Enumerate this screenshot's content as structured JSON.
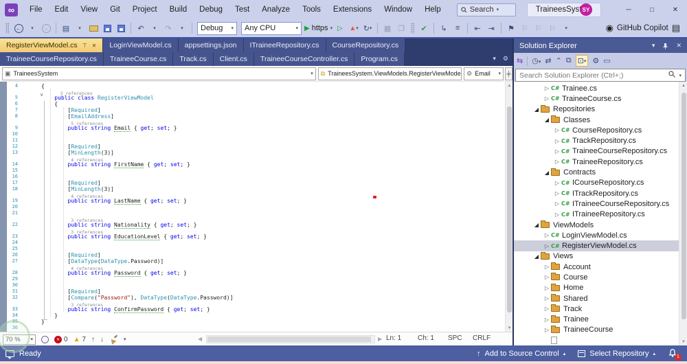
{
  "titlebar": {
    "menus": [
      "File",
      "Edit",
      "View",
      "Git",
      "Project",
      "Build",
      "Debug",
      "Test",
      "Analyze",
      "Tools",
      "Extensions",
      "Window",
      "Help"
    ],
    "search_label": "Search",
    "project_title": "TraineesSystem",
    "avatar": "SY"
  },
  "toolbar": {
    "debug_config": "Debug",
    "cpu": "Any CPU",
    "run_target": "https",
    "copilot_label": "GitHub Copilot"
  },
  "tabs": {
    "row1": [
      {
        "label": "RegisterViewModel.cs",
        "active": true
      },
      {
        "label": "LoginViewModel.cs"
      },
      {
        "label": "appsettings.json"
      },
      {
        "label": "ITraineeRepository.cs"
      },
      {
        "label": "CourseRepository.cs"
      }
    ],
    "row2": [
      {
        "label": "TraineeCourseRepository.cs"
      },
      {
        "label": "TraineeCourse.cs"
      },
      {
        "label": "Track.cs"
      },
      {
        "label": "Client.cs"
      },
      {
        "label": "TraineeCourseController.cs"
      },
      {
        "label": "Program.cs"
      }
    ]
  },
  "navbar": {
    "project": "TraineesSystem",
    "type": "TraineesSystem.ViewModels.RegisterViewModel",
    "member": "Email"
  },
  "editor": {
    "lines": [
      {
        "n": 4,
        "t": [
          [
            "p",
            "{"
          ]
        ]
      },
      {
        "n": 5,
        "lens": "    3 references",
        "t": [
          [
            "p",
            "    "
          ],
          [
            "k",
            "public"
          ],
          [
            "p",
            " "
          ],
          [
            "k",
            "class"
          ],
          [
            "p",
            " "
          ],
          [
            "t",
            "RegisterViewModel"
          ]
        ]
      },
      {
        "n": 6,
        "t": [
          [
            "p",
            "    {"
          ]
        ]
      },
      {
        "n": 7,
        "t": [
          [
            "p",
            "        ["
          ],
          [
            "t",
            "Required"
          ],
          [
            "p",
            "]"
          ]
        ]
      },
      {
        "n": 8,
        "t": [
          [
            "p",
            "        ["
          ],
          [
            "t",
            "EmailAddress"
          ],
          [
            "p",
            "]"
          ]
        ]
      },
      {
        "n": 9,
        "lens": "        5 references",
        "t": [
          [
            "p",
            "        "
          ],
          [
            "k",
            "public"
          ],
          [
            "p",
            " "
          ],
          [
            "k",
            "string"
          ],
          [
            "p",
            " "
          ],
          [
            "u",
            "Email"
          ],
          [
            "p",
            " { "
          ],
          [
            "k",
            "get"
          ],
          [
            "p",
            "; "
          ],
          [
            "k",
            "set"
          ],
          [
            "p",
            "; }"
          ]
        ]
      },
      {
        "n": 10,
        "t": []
      },
      {
        "n": 11,
        "t": []
      },
      {
        "n": 12,
        "t": [
          [
            "p",
            "        ["
          ],
          [
            "t",
            "Required"
          ],
          [
            "p",
            "]"
          ]
        ]
      },
      {
        "n": 13,
        "t": [
          [
            "p",
            "        ["
          ],
          [
            "t",
            "MinLength"
          ],
          [
            "p",
            "(3)]"
          ]
        ]
      },
      {
        "n": 14,
        "lens": "        4 references",
        "t": [
          [
            "p",
            "        "
          ],
          [
            "k",
            "public"
          ],
          [
            "p",
            " "
          ],
          [
            "k",
            "string"
          ],
          [
            "p",
            " "
          ],
          [
            "u",
            "FirstName"
          ],
          [
            "p",
            " { "
          ],
          [
            "k",
            "get"
          ],
          [
            "p",
            "; "
          ],
          [
            "k",
            "set"
          ],
          [
            "p",
            "; }"
          ]
        ]
      },
      {
        "n": 15,
        "t": []
      },
      {
        "n": 16,
        "t": []
      },
      {
        "n": 17,
        "t": [
          [
            "p",
            "        ["
          ],
          [
            "t",
            "Required"
          ],
          [
            "p",
            "]"
          ]
        ]
      },
      {
        "n": 18,
        "t": [
          [
            "p",
            "        ["
          ],
          [
            "t",
            "MinLength"
          ],
          [
            "p",
            "(3)]"
          ]
        ]
      },
      {
        "n": 19,
        "lens": "        4 references",
        "t": [
          [
            "p",
            "        "
          ],
          [
            "k",
            "public"
          ],
          [
            "p",
            " "
          ],
          [
            "k",
            "string"
          ],
          [
            "p",
            " "
          ],
          [
            "u",
            "LastName"
          ],
          [
            "p",
            " { "
          ],
          [
            "k",
            "get"
          ],
          [
            "p",
            "; "
          ],
          [
            "k",
            "set"
          ],
          [
            "p",
            "; }"
          ]
        ]
      },
      {
        "n": 20,
        "t": []
      },
      {
        "n": 21,
        "t": []
      },
      {
        "n": 22,
        "lens": "        3 references",
        "t": [
          [
            "p",
            "        "
          ],
          [
            "k",
            "public"
          ],
          [
            "p",
            " "
          ],
          [
            "k",
            "string"
          ],
          [
            "p",
            " "
          ],
          [
            "u",
            "Nationality"
          ],
          [
            "p",
            " { "
          ],
          [
            "k",
            "get"
          ],
          [
            "p",
            "; "
          ],
          [
            "k",
            "set"
          ],
          [
            "p",
            "; }"
          ]
        ]
      },
      {
        "n": 23,
        "lens": "        3 references",
        "t": [
          [
            "p",
            "        "
          ],
          [
            "k",
            "public"
          ],
          [
            "p",
            " "
          ],
          [
            "k",
            "string"
          ],
          [
            "p",
            " "
          ],
          [
            "u",
            "EducationLevel"
          ],
          [
            "p",
            " { "
          ],
          [
            "k",
            "get"
          ],
          [
            "p",
            "; "
          ],
          [
            "k",
            "set"
          ],
          [
            "p",
            "; }"
          ]
        ]
      },
      {
        "n": 24,
        "t": []
      },
      {
        "n": 25,
        "t": []
      },
      {
        "n": 26,
        "t": [
          [
            "p",
            "        ["
          ],
          [
            "t",
            "Required"
          ],
          [
            "p",
            "]"
          ]
        ]
      },
      {
        "n": 27,
        "t": [
          [
            "p",
            "        ["
          ],
          [
            "t",
            "DataType"
          ],
          [
            "p",
            "("
          ],
          [
            "t",
            "DataType"
          ],
          [
            "p",
            ".Password)]"
          ]
        ]
      },
      {
        "n": 28,
        "lens": "        4 references",
        "t": [
          [
            "p",
            "        "
          ],
          [
            "k",
            "public"
          ],
          [
            "p",
            " "
          ],
          [
            "k",
            "string"
          ],
          [
            "p",
            " "
          ],
          [
            "u",
            "Password"
          ],
          [
            "p",
            " { "
          ],
          [
            "k",
            "get"
          ],
          [
            "p",
            "; "
          ],
          [
            "k",
            "set"
          ],
          [
            "p",
            "; }"
          ]
        ]
      },
      {
        "n": 29,
        "t": []
      },
      {
        "n": 30,
        "t": []
      },
      {
        "n": 31,
        "t": [
          [
            "p",
            "        ["
          ],
          [
            "t",
            "Required"
          ],
          [
            "p",
            "]"
          ]
        ]
      },
      {
        "n": 32,
        "t": [
          [
            "p",
            "        ["
          ],
          [
            "t",
            "Compare"
          ],
          [
            "p",
            "("
          ],
          [
            "s",
            "\"Password\""
          ],
          [
            "p",
            "), "
          ],
          [
            "t",
            "DataType"
          ],
          [
            "p",
            "("
          ],
          [
            "t",
            "DataType"
          ],
          [
            "p",
            ".Password)]"
          ]
        ]
      },
      {
        "n": 33,
        "lens": "        3 references",
        "t": [
          [
            "p",
            "        "
          ],
          [
            "k",
            "public"
          ],
          [
            "p",
            " "
          ],
          [
            "k",
            "string"
          ],
          [
            "p",
            " "
          ],
          [
            "u",
            "ConfirmPassword"
          ],
          [
            "p",
            " { "
          ],
          [
            "k",
            "get"
          ],
          [
            "p",
            "; "
          ],
          [
            "k",
            "set"
          ],
          [
            "p",
            "; }"
          ]
        ]
      },
      {
        "n": 34,
        "t": [
          [
            "p",
            "    }"
          ]
        ]
      },
      {
        "n": 35,
        "t": [
          [
            "p",
            "}"
          ]
        ]
      },
      {
        "n": 36,
        "t": []
      }
    ],
    "status": {
      "zoom": "70 %",
      "errors": "0",
      "warnings": "7",
      "ln": "Ln: 1",
      "ch": "Ch: 1",
      "spc": "SPC",
      "eol": "CRLF"
    }
  },
  "solution_explorer": {
    "title": "Solution Explorer",
    "search_placeholder": "Search Solution Explorer (Ctrl+;)",
    "tree": [
      {
        "l": "Trainee.cs",
        "k": "cs",
        "lv": 3,
        "e": "closed"
      },
      {
        "l": "TraineeCourse.cs",
        "k": "cs",
        "lv": 3,
        "e": "closed"
      },
      {
        "l": "Repositories",
        "k": "folder",
        "lv": 2,
        "e": "open"
      },
      {
        "l": "Classes",
        "k": "folder",
        "lv": 3,
        "e": "open"
      },
      {
        "l": "CourseRepository.cs",
        "k": "cs",
        "lv": 4,
        "e": "closed"
      },
      {
        "l": "TrackRepository.cs",
        "k": "cs",
        "lv": 4,
        "e": "closed"
      },
      {
        "l": "TraineeCourseRepository.cs",
        "k": "cs",
        "lv": 4,
        "e": "closed"
      },
      {
        "l": "TraineeRepository.cs",
        "k": "cs",
        "lv": 4,
        "e": "closed"
      },
      {
        "l": "Contracts",
        "k": "folder",
        "lv": 3,
        "e": "open"
      },
      {
        "l": "ICourseRepository.cs",
        "k": "cs",
        "lv": 4,
        "e": "closed"
      },
      {
        "l": "ITrackRepository.cs",
        "k": "cs",
        "lv": 4,
        "e": "closed"
      },
      {
        "l": "ITraineeCourseRepository.cs",
        "k": "cs",
        "lv": 4,
        "e": "closed"
      },
      {
        "l": "ITraineeRepository.cs",
        "k": "cs",
        "lv": 4,
        "e": "closed"
      },
      {
        "l": "ViewModels",
        "k": "folder",
        "lv": 2,
        "e": "open"
      },
      {
        "l": "LoginViewModel.cs",
        "k": "cs",
        "lv": 3,
        "e": "closed"
      },
      {
        "l": "RegisterViewModel.cs",
        "k": "cs",
        "lv": 3,
        "e": "closed",
        "sel": true
      },
      {
        "l": "Views",
        "k": "folder",
        "lv": 2,
        "e": "open"
      },
      {
        "l": "Account",
        "k": "folder",
        "lv": 3,
        "e": "closed"
      },
      {
        "l": "Course",
        "k": "folder",
        "lv": 3,
        "e": "closed"
      },
      {
        "l": "Home",
        "k": "folder",
        "lv": 3,
        "e": "closed"
      },
      {
        "l": "Shared",
        "k": "folder",
        "lv": 3,
        "e": "closed"
      },
      {
        "l": "Track",
        "k": "folder",
        "lv": 3,
        "e": "closed"
      },
      {
        "l": "Trainee",
        "k": "folder",
        "lv": 3,
        "e": "closed"
      },
      {
        "l": "TraineeCourse",
        "k": "folder",
        "lv": 3,
        "e": "closed"
      },
      {
        "l": "",
        "k": "file",
        "lv": 3,
        "e": null
      }
    ]
  },
  "statusbar": {
    "ready": "Ready",
    "add_to_source_control": "Add to Source Control",
    "select_repository": "Select Repository",
    "notifications": "1"
  },
  "colors": {
    "accent_yellow": "#F3CB74",
    "keyword": "#0000EE",
    "type": "#2B91AF",
    "string": "#A31515",
    "status_blue": "#4D5FA1",
    "titlebar": "#CBD1EB",
    "tab_inactive": "#46548E",
    "selection_gray": "#CCCEDB"
  }
}
